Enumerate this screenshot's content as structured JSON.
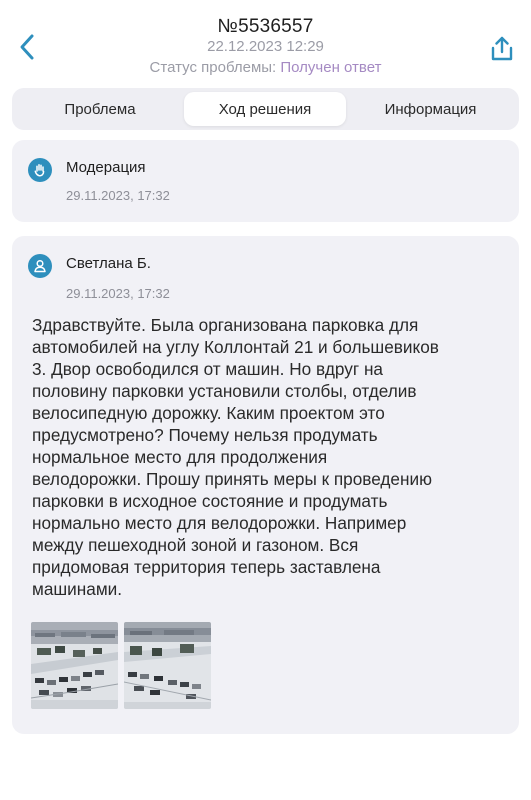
{
  "header": {
    "title": "№5536557",
    "datetime": "22.12.2023 12:29",
    "status_label": "Статус проблемы:",
    "status_value": "Получен ответ",
    "back_icon": "chevron-left-icon",
    "share_icon": "share-icon"
  },
  "tabs": [
    {
      "label": "Проблема",
      "active": false
    },
    {
      "label": "Ход решения",
      "active": true
    },
    {
      "label": "Информация",
      "active": false
    }
  ],
  "events": [
    {
      "icon": "hand-icon",
      "author": "Модерация",
      "date": "29.11.2023, 17:32"
    },
    {
      "icon": "user-icon",
      "author": "Светлана Б.",
      "date": "29.11.2023, 17:32",
      "message": "Здравствуйте. Была организована парковка для\nавтомобилей на углу Коллонтай 21 и большевиков\n3. Двор освободился от машин.  Но вдруг на\nполовину парковки установили столбы, отделив\nвелосипедную дорожку. Каким проектом это\nпредусмотрено? Почему нельзя продумать\nнормальное место для продолжения\nвелодорожки. Прошу принять меры к проведению\nпарковки в исходное состояние и продумать\nнормально место для велодорожки. Например\nмежду пешеходной зоной и газоном. Вся\nпридомовая территория теперь заставлена\nмашинами.",
      "photos": [
        "photo-thumbnail",
        "photo-thumbnail"
      ]
    }
  ],
  "colors": {
    "accent": "#2e8fbd",
    "status_value": "#a58ac3",
    "card_bg": "#f1f1f6",
    "muted_text": "#9b9ca6"
  }
}
